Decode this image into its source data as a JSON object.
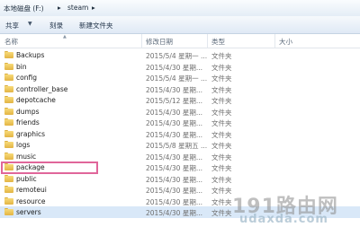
{
  "breadcrumb": {
    "drive": "本地磁盘 (F:)",
    "folder": "steam",
    "sep": "▸"
  },
  "toolbar": {
    "share": "共享",
    "burn": "刻录",
    "new_folder": "新建文件夹",
    "chevron": "▼"
  },
  "columns": {
    "name": "名称",
    "date": "修改日期",
    "type": "类型",
    "size": "大小"
  },
  "rows": [
    {
      "name": "Backups",
      "date": "2015/5/4 星期一 ...",
      "type": "文件夹"
    },
    {
      "name": "bin",
      "date": "2015/4/30 星期...",
      "type": "文件夹"
    },
    {
      "name": "config",
      "date": "2015/5/4 星期一 ...",
      "type": "文件夹"
    },
    {
      "name": "controller_base",
      "date": "2015/4/30 星期...",
      "type": "文件夹"
    },
    {
      "name": "depotcache",
      "date": "2015/5/12 星期...",
      "type": "文件夹"
    },
    {
      "name": "dumps",
      "date": "2015/4/30 星期...",
      "type": "文件夹"
    },
    {
      "name": "friends",
      "date": "2015/4/30 星期...",
      "type": "文件夹"
    },
    {
      "name": "graphics",
      "date": "2015/4/30 星期...",
      "type": "文件夹"
    },
    {
      "name": "logs",
      "date": "2015/5/8 星期五 ...",
      "type": "文件夹"
    },
    {
      "name": "music",
      "date": "2015/4/30 星期...",
      "type": "文件夹"
    },
    {
      "name": "package",
      "date": "2015/4/30 星期...",
      "type": "文件夹"
    },
    {
      "name": "public",
      "date": "2015/4/30 星期...",
      "type": "文件夹"
    },
    {
      "name": "remoteui",
      "date": "2015/4/30 星期...",
      "type": "文件夹"
    },
    {
      "name": "resource",
      "date": "2015/4/30 星期...",
      "type": "文件夹"
    },
    {
      "name": "servers",
      "date": "2015/4/30 星期...",
      "type": "文件夹"
    }
  ],
  "watermark": {
    "line1": "191路由网",
    "line2": "udaxda.com"
  },
  "colors": {
    "highlight_box": "#e0669a",
    "selected_row": "#d9e8f8"
  }
}
